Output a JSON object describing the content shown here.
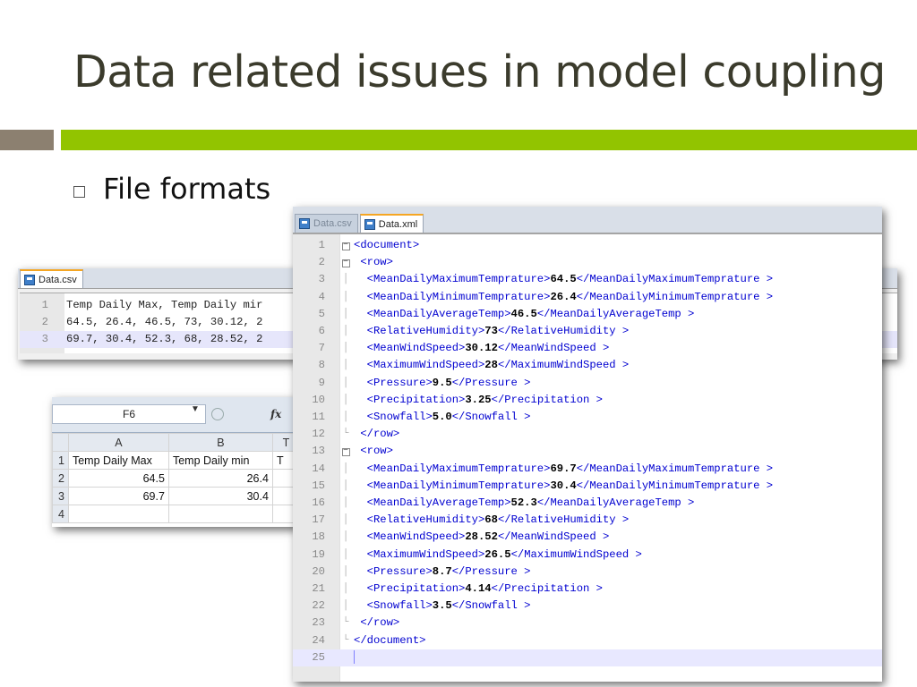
{
  "slide": {
    "title": "Data related issues in model coupling",
    "bullet": "File formats"
  },
  "colors": {
    "title": "#3b3b2c",
    "bar_brown": "#8c8070",
    "bar_green": "#92c400",
    "tab_accent": "#f5a623",
    "xml_tag": "#0000d0"
  },
  "csv_editor": {
    "tab_label": "Data.csv",
    "lines": [
      {
        "num": "1",
        "text": "Temp Daily Max, Temp Daily mir"
      },
      {
        "num": "2",
        "text": "64.5, 26.4, 46.5, 73, 30.12, 2"
      },
      {
        "num": "3",
        "text": "69.7, 30.4, 52.3, 68, 28.52, 2"
      }
    ]
  },
  "spreadsheet": {
    "name_box": "F6",
    "fx_label": "fx",
    "columns": [
      "A",
      "B",
      "T"
    ],
    "rows": [
      {
        "num": "1",
        "cells": [
          "Temp Daily Max",
          "Temp Daily min",
          "T"
        ]
      },
      {
        "num": "2",
        "cells": [
          "64.5",
          "26.4",
          ""
        ]
      },
      {
        "num": "3",
        "cells": [
          "69.7",
          "30.4",
          ""
        ]
      },
      {
        "num": "4",
        "cells": [
          "",
          "",
          ""
        ]
      }
    ]
  },
  "xml_editor": {
    "tabs": [
      {
        "label": "Data.csv",
        "active": false
      },
      {
        "label": "Data.xml",
        "active": true
      }
    ],
    "lines": [
      {
        "num": "1",
        "fold": "minus",
        "indent": "",
        "tag": "document",
        "value": null,
        "close": false
      },
      {
        "num": "2",
        "fold": "minus",
        "indent": " ",
        "tag": "row",
        "value": null,
        "close": false
      },
      {
        "num": "3",
        "fold": "bar",
        "indent": "  ",
        "tag": "MeanDailyMaximumTemprature",
        "value": "64.5",
        "close_text": "</MeanDailyMaximumTemprature >"
      },
      {
        "num": "4",
        "fold": "bar",
        "indent": "  ",
        "tag": "MeanDailyMinimumTemprature",
        "value": "26.4",
        "close_text": "</MeanDailyMinimumTemprature >"
      },
      {
        "num": "5",
        "fold": "bar",
        "indent": "  ",
        "tag": "MeanDailyAverageTemp",
        "value": "46.5",
        "close_text": "</MeanDailyAverageTemp >"
      },
      {
        "num": "6",
        "fold": "bar",
        "indent": "  ",
        "tag": "RelativeHumidity",
        "value": "73",
        "close_text": "</RelativeHumidity >"
      },
      {
        "num": "7",
        "fold": "bar",
        "indent": "  ",
        "tag": "MeanWindSpeed",
        "value": "30.12",
        "close_text": "</MeanWindSpeed >"
      },
      {
        "num": "8",
        "fold": "bar",
        "indent": "  ",
        "tag": "MaximumWindSpeed",
        "value": "28",
        "close_text": "</MaximumWindSpeed >"
      },
      {
        "num": "9",
        "fold": "bar",
        "indent": "  ",
        "tag": "Pressure",
        "value": "9.5",
        "close_text": "</Pressure >"
      },
      {
        "num": "10",
        "fold": "bar",
        "indent": "  ",
        "tag": "Precipitation",
        "value": "3.25",
        "close_text": "</Precipitation >"
      },
      {
        "num": "11",
        "fold": "bar",
        "indent": "  ",
        "tag": "Snowfall",
        "value": "5.0",
        "close_text": "</Snowfall >"
      },
      {
        "num": "12",
        "fold": "end",
        "indent": " ",
        "tag": "/row",
        "value": null,
        "close": false
      },
      {
        "num": "13",
        "fold": "minus",
        "indent": " ",
        "tag": "row",
        "value": null,
        "close": false
      },
      {
        "num": "14",
        "fold": "bar",
        "indent": "  ",
        "tag": "MeanDailyMaximumTemprature",
        "value": "69.7",
        "close_text": "</MeanDailyMaximumTemprature >"
      },
      {
        "num": "15",
        "fold": "bar",
        "indent": "  ",
        "tag": "MeanDailyMinimumTemprature",
        "value": "30.4",
        "close_text": "</MeanDailyMinimumTemprature >"
      },
      {
        "num": "16",
        "fold": "bar",
        "indent": "  ",
        "tag": "MeanDailyAverageTemp",
        "value": "52.3",
        "close_text": "</MeanDailyAverageTemp >"
      },
      {
        "num": "17",
        "fold": "bar",
        "indent": "  ",
        "tag": "RelativeHumidity",
        "value": "68",
        "close_text": "</RelativeHumidity >"
      },
      {
        "num": "18",
        "fold": "bar",
        "indent": "  ",
        "tag": "MeanWindSpeed",
        "value": "28.52",
        "close_text": "</MeanWindSpeed >"
      },
      {
        "num": "19",
        "fold": "bar",
        "indent": "  ",
        "tag": "MaximumWindSpeed",
        "value": "26.5",
        "close_text": "</MaximumWindSpeed >"
      },
      {
        "num": "20",
        "fold": "bar",
        "indent": "  ",
        "tag": "Pressure",
        "value": "8.7",
        "close_text": "</Pressure >"
      },
      {
        "num": "21",
        "fold": "bar",
        "indent": "  ",
        "tag": "Precipitation",
        "value": "4.14",
        "close_text": "</Precipitation >"
      },
      {
        "num": "22",
        "fold": "bar",
        "indent": "  ",
        "tag": "Snowfall",
        "value": "3.5",
        "close_text": "</Snowfall >"
      },
      {
        "num": "23",
        "fold": "end",
        "indent": " ",
        "tag": "/row",
        "value": null,
        "close": false
      },
      {
        "num": "24",
        "fold": "last",
        "indent": "",
        "tag": "/document",
        "value": null,
        "close": false
      },
      {
        "num": "25",
        "fold": "",
        "indent": "",
        "tag": "",
        "value": null,
        "close": false
      }
    ]
  }
}
